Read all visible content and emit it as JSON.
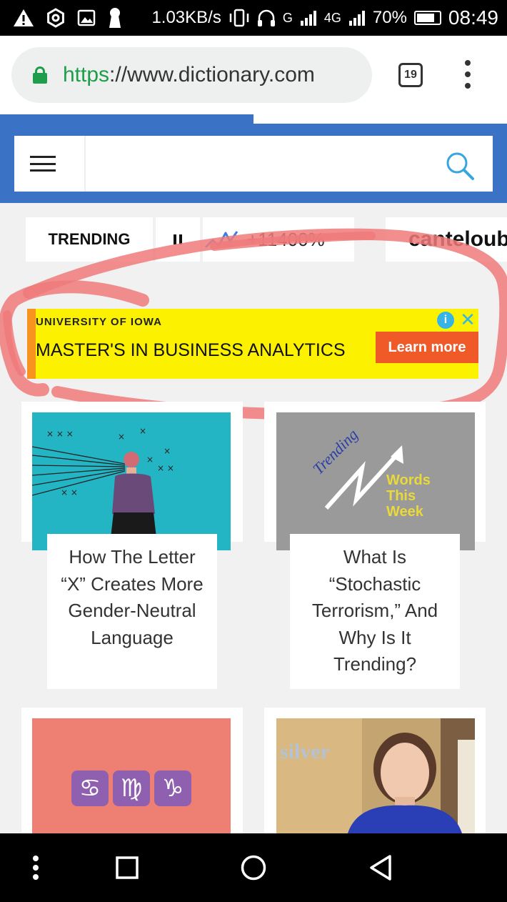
{
  "status_bar": {
    "speed": "1.03KB/s",
    "network_1": "G",
    "network_2": "4G",
    "battery": "70%",
    "time": "08:49"
  },
  "browser": {
    "url_scheme": "https",
    "url_rest": "://www.dictionary.com",
    "tab_count": "19"
  },
  "search": {
    "placeholder": ""
  },
  "trending": {
    "label": "TRENDING",
    "change": "+11400%",
    "word": "canteloub"
  },
  "ad": {
    "brand": "UNIVERSITY OF IOWA",
    "headline": "MASTER'S IN BUSINESS ANALYTICS",
    "cta": "Learn more",
    "info": "i",
    "close": "✕"
  },
  "cards": [
    {
      "title": "How The Letter “X” Creates More Gender-Neutral Language"
    },
    {
      "title": "What Is “Stochastic Terrorism,” And Why Is It Trending?",
      "image_text_1": "Trending",
      "image_text_2": "Words",
      "image_text_3": "This",
      "image_text_4": "Week"
    },
    {
      "image_glyphs": [
        "♋",
        "♍",
        "♑"
      ]
    },
    {
      "image_text": "silver"
    }
  ],
  "colors": {
    "header_blue": "#3a73c5",
    "ad_yellow": "#fcf200",
    "ad_cta": "#f05a28",
    "lock_green": "#1e9e4a",
    "annotation_red": "#f07a7a"
  },
  "icons": {
    "status": [
      "warning-icon",
      "settings-icon",
      "image-icon",
      "keyhole-icon",
      "vibrate-icon",
      "headphones-icon",
      "signal-icon",
      "battery-icon"
    ],
    "nav": [
      "more-icon",
      "recents-icon",
      "home-icon",
      "back-icon"
    ]
  }
}
